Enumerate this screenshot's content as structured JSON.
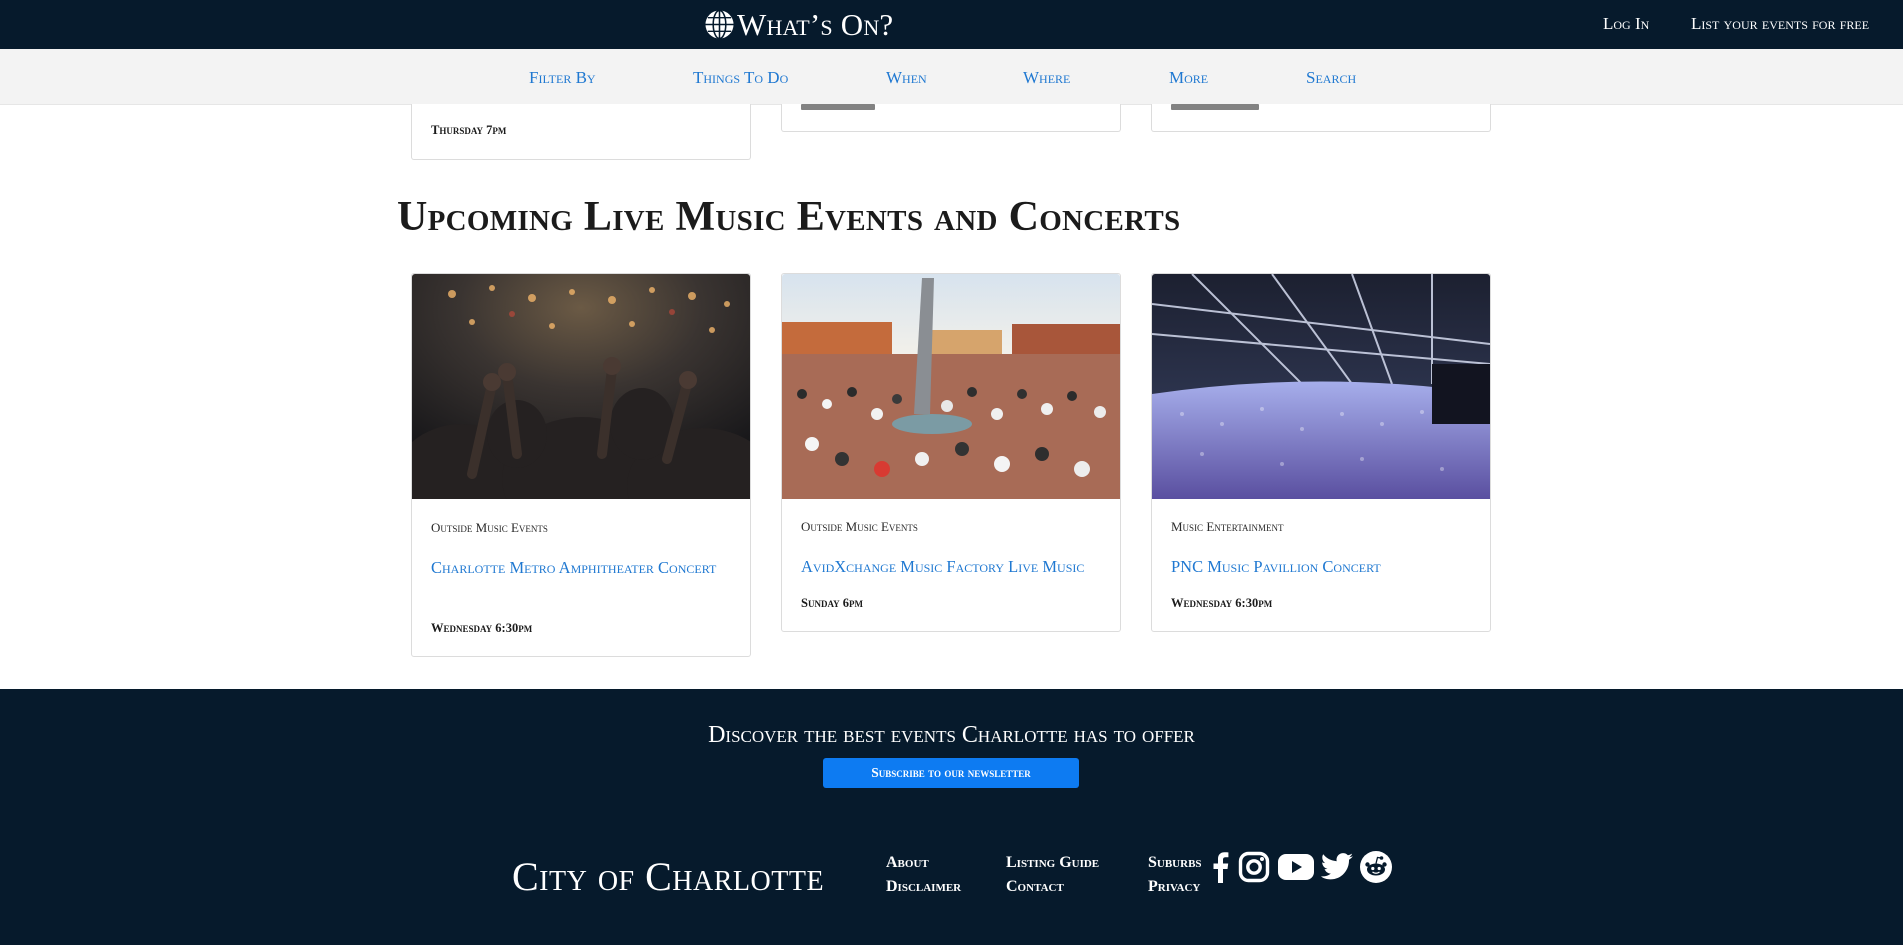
{
  "header": {
    "logo_text": "What’s On?",
    "login_label": "Log In",
    "list_events_label": "List your events for free"
  },
  "filter_bar": {
    "items": [
      "Filter By",
      "Things To Do",
      "When",
      "Where",
      "More",
      "Search"
    ]
  },
  "previous_row": {
    "card1_when": "Thursday 7pm"
  },
  "section": {
    "title": "Upcoming Live Music Events and Concerts"
  },
  "events": [
    {
      "category": "Outside Music Events",
      "title": "Charlotte Metro Amphitheater Concert",
      "when": "Wednesday 6:30pm"
    },
    {
      "category": "Outside Music Events",
      "title": "AvidXchange Music Factory Live Music",
      "when": "Sunday 6pm"
    },
    {
      "category": "Music Entertainment",
      "title": "PNC Music Pavillion Concert",
      "when": "Wednesday 6:30pm"
    }
  ],
  "footer": {
    "tagline": "Discover the best events Charlotte has to offer",
    "subscribe_label": "Subscribe to our newsletter",
    "brand": "City of Charlotte",
    "links": [
      "About",
      "Disclaimer",
      "Listing Guide",
      "Contact",
      "Suburbs",
      "Privacy"
    ],
    "social_icons": [
      "facebook-icon",
      "instagram-icon",
      "youtube-icon",
      "twitter-icon",
      "reddit-icon"
    ]
  },
  "colors": {
    "navy": "#061a2c",
    "link_blue": "#1f78d1",
    "button_blue": "#0d7bf2",
    "filter_bg": "#f3f3f3"
  }
}
